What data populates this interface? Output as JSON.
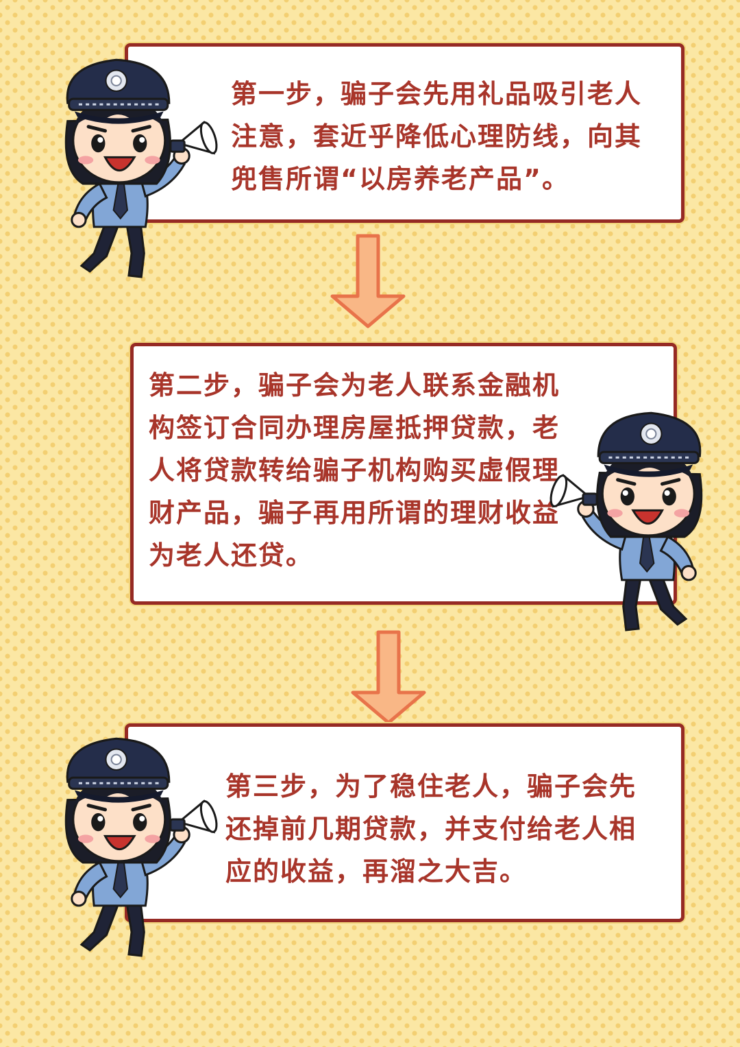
{
  "steps": [
    {
      "text": "第一步，骗子会先用礼品吸引老人注意，套近乎降低心理防线，向其兜售所谓“以房养老产品”。"
    },
    {
      "text": "第二步，骗子会为老人联系金融机构签订合同办理房屋抵押贷款，老人将贷款转给骗子机构购买虚假理财产品，骗子再用所谓的理财收益为老人还贷。"
    },
    {
      "text": "第三步，为了稳住老人，骗子会先还掉前几期贷款，并支付给老人相应的收益，再溜之大吉。"
    }
  ],
  "colors": {
    "background": "#fbe7a4",
    "dots": "#f3cf72",
    "card_border": "#962a24",
    "text": "#a8352a",
    "arrow_fill": "#f9b786",
    "arrow_outline": "#e8734a"
  },
  "icons": {
    "mascot": "police-officer-megaphone-icon",
    "arrow": "arrow-down-icon",
    "badge": "police-badge-icon"
  }
}
